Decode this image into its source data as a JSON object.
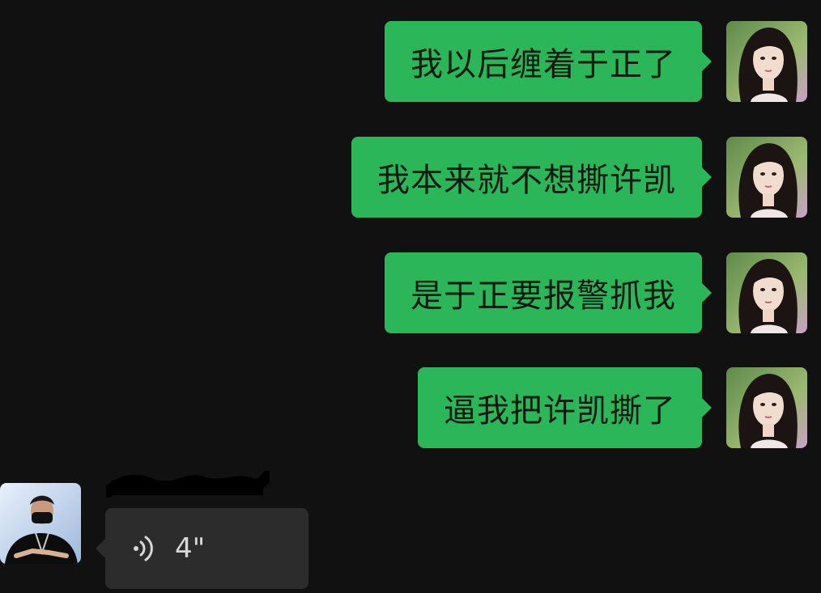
{
  "messages_sent": [
    {
      "text": "我以后缠着于正了"
    },
    {
      "text": "我本来就不想撕许凯"
    },
    {
      "text": "是于正要报警抓我"
    },
    {
      "text": "逼我把许凯撕了"
    }
  ],
  "incoming": {
    "voice_duration": "4\""
  },
  "colors": {
    "background": "#111111",
    "sent_bubble": "#2bb65a",
    "received_bubble": "#2c2c2c"
  },
  "icons": {
    "voice": "sound-wave-icon"
  }
}
